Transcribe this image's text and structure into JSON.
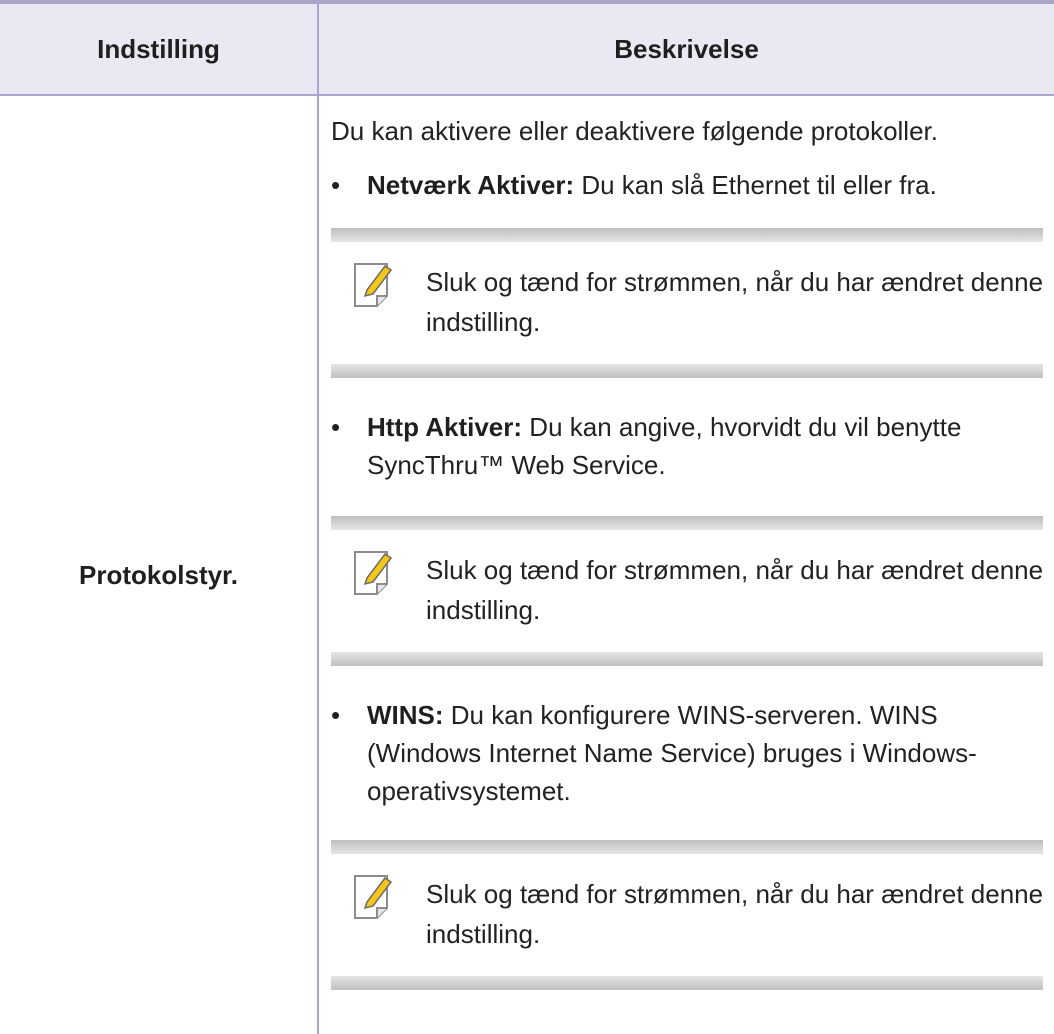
{
  "table": {
    "headers": {
      "setting": "Indstilling",
      "description": "Beskrivelse"
    },
    "row": {
      "setting": "Protokolstyr.",
      "intro": "Du kan aktivere eller deaktivere følgende protokoller.",
      "items": [
        {
          "term": "Netværk Aktiver:",
          "text": " Du kan slå Ethernet til eller fra.",
          "note": "Sluk og tænd for strømmen, når du har ændret denne indstilling."
        },
        {
          "term": "Http Aktiver:",
          "text": " Du kan angive, hvorvidt du vil benytte SyncThru™ Web Service.",
          "note": "Sluk og tænd for strømmen, når du har ændret denne indstilling."
        },
        {
          "term": "WINS:",
          "text": " Du kan konfigurere WINS-serveren. WINS (Windows Internet Name Service) bruges i Windows-operativsystemet.",
          "note": "Sluk og tænd for strømmen, når du har ændret denne indstilling."
        }
      ]
    }
  },
  "icons": {
    "bullet": "bullet-dot",
    "note": "note-pencil-icon"
  },
  "colors": {
    "header_bg": "#e9e8f3",
    "rule": "#a9a6c8",
    "note_bar": "#bfbfbf",
    "pencil": "#f5c518"
  }
}
